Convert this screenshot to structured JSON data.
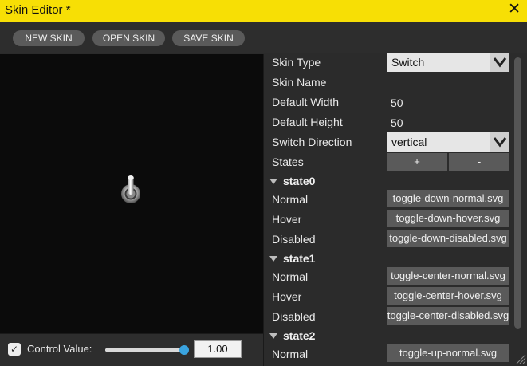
{
  "window": {
    "title": "Skin Editor *",
    "close_glyph": "✕"
  },
  "toolbar": {
    "new_label": "NEW SKIN",
    "open_label": "OPEN SKIN",
    "save_label": "SAVE SKIN"
  },
  "control": {
    "checkbox_checked": true,
    "label": "Control Value:",
    "slider_fraction": 1.0,
    "value": "1.00"
  },
  "props": {
    "skin_type_label": "Skin Type",
    "skin_type_value": "Switch",
    "skin_name_label": "Skin Name",
    "skin_name_value": "",
    "default_width_label": "Default Width",
    "default_width_value": "50",
    "default_height_label": "Default Height",
    "default_height_value": "50",
    "switch_direction_label": "Switch Direction",
    "switch_direction_value": "vertical",
    "states_label": "States",
    "states_add": "+",
    "states_remove": "-"
  },
  "states": [
    {
      "name": "state0",
      "normal_label": "Normal",
      "normal": "toggle-down-normal.svg",
      "hover_label": "Hover",
      "hover": "toggle-down-hover.svg",
      "disabled_label": "Disabled",
      "disabled": "toggle-down-disabled.svg"
    },
    {
      "name": "state1",
      "normal_label": "Normal",
      "normal": "toggle-center-normal.svg",
      "hover_label": "Hover",
      "hover": "toggle-center-hover.svg",
      "disabled_label": "Disabled",
      "disabled": "toggle-center-disabled.svg"
    },
    {
      "name": "state2",
      "normal_label": "Normal",
      "normal": "toggle-up-normal.svg"
    }
  ],
  "colors": {
    "titlebar": "#f7df05",
    "accent": "#3aa4e0",
    "panel": "#2b2b2b",
    "preview_bg": "#0b0b0b",
    "button": "#5a5a5a"
  }
}
